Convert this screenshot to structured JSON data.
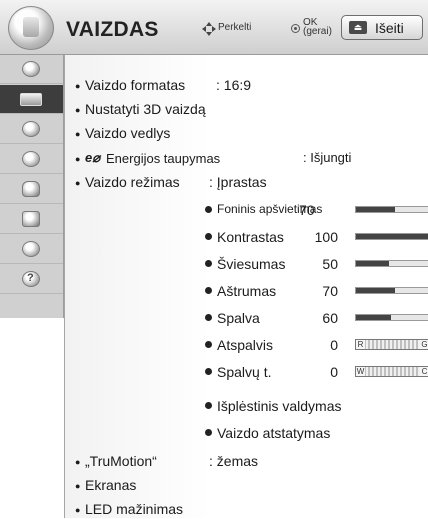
{
  "header": {
    "title": "VAIZDAS",
    "move_hint": "Perkelti",
    "ok_hint_top": "OK",
    "ok_hint_bottom": "(gerai)",
    "exit_key": "⏏",
    "exit_label": "Išeiti"
  },
  "sidebar": {
    "items": [
      {
        "icon": "satellite-icon",
        "selected": false
      },
      {
        "icon": "picture-icon",
        "selected": true
      },
      {
        "icon": "speaker-icon",
        "selected": false
      },
      {
        "icon": "clock-icon",
        "selected": false
      },
      {
        "icon": "lock-icon",
        "selected": false
      },
      {
        "icon": "usb-icon",
        "selected": false
      },
      {
        "icon": "network-icon",
        "selected": false
      },
      {
        "icon": "help-icon",
        "selected": false
      }
    ]
  },
  "menu": {
    "aspect_label": "Vaizdo formatas",
    "aspect_value": ": 16:9",
    "set_3d_label": "Nustatyti 3D vaizdą",
    "wizard_label": "Vaizdo vedlys",
    "energy_logo": "e⌀",
    "energy_label": "Energijos taupymas",
    "energy_value": ": Išjungti",
    "mode_label": "Vaizdo režimas",
    "mode_value": ": Įprastas",
    "truemotion_label": "„TruMotion“",
    "truemotion_value": ": žemas",
    "screen_label": "Ekranas",
    "led_label": "LED mažinimas"
  },
  "picture_settings": [
    {
      "label": "Foninis apšvietimas",
      "value": "70",
      "level": 0.53
    },
    {
      "label": "Kontrastas",
      "value": "100",
      "level": 1.0
    },
    {
      "label": "Šviesumas",
      "value": "50",
      "level": 0.45
    },
    {
      "label": "Aštrumas",
      "value": "70",
      "level": 0.53
    },
    {
      "label": "Spalva",
      "value": "60",
      "level": 0.48
    }
  ],
  "balance_settings": [
    {
      "label": "Atspalvis",
      "value": "0",
      "left": "R",
      "right": "G"
    },
    {
      "label": "Spalvų t.",
      "value": "0",
      "left": "W",
      "right": "C"
    }
  ],
  "advanced": {
    "expert_label": "Išplėstinis valdymas",
    "reset_label": "Vaizdo atstatymas"
  }
}
